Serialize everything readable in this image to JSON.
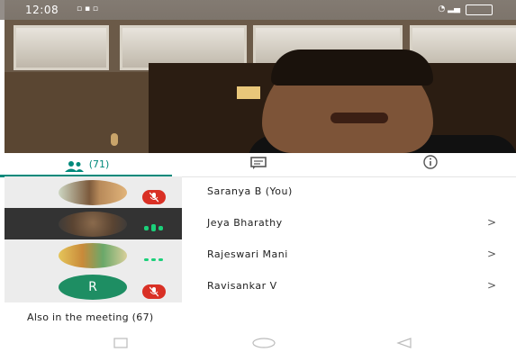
{
  "status_bar": {
    "time": "12:08"
  },
  "tabs": {
    "people_count": "(71)",
    "people_icon": "people-icon",
    "chat_icon": "chat-icon",
    "info_icon": "info-icon"
  },
  "participants": [
    {
      "name": "Saranya B (You)",
      "status": "muted",
      "avatar_letter": ""
    },
    {
      "name": "Jeya Bharathy",
      "status": "speaking",
      "avatar_letter": ""
    },
    {
      "name": "Rajeswari Mani",
      "status": "idle",
      "avatar_letter": ""
    },
    {
      "name": "Ravisankar V",
      "status": "muted",
      "avatar_letter": "R"
    }
  ],
  "chevron": ">",
  "also_in_meeting": "Also in the meeting (67)",
  "colors": {
    "accent": "#00897b",
    "muted": "#d93025",
    "speaking": "#1bd07a"
  }
}
